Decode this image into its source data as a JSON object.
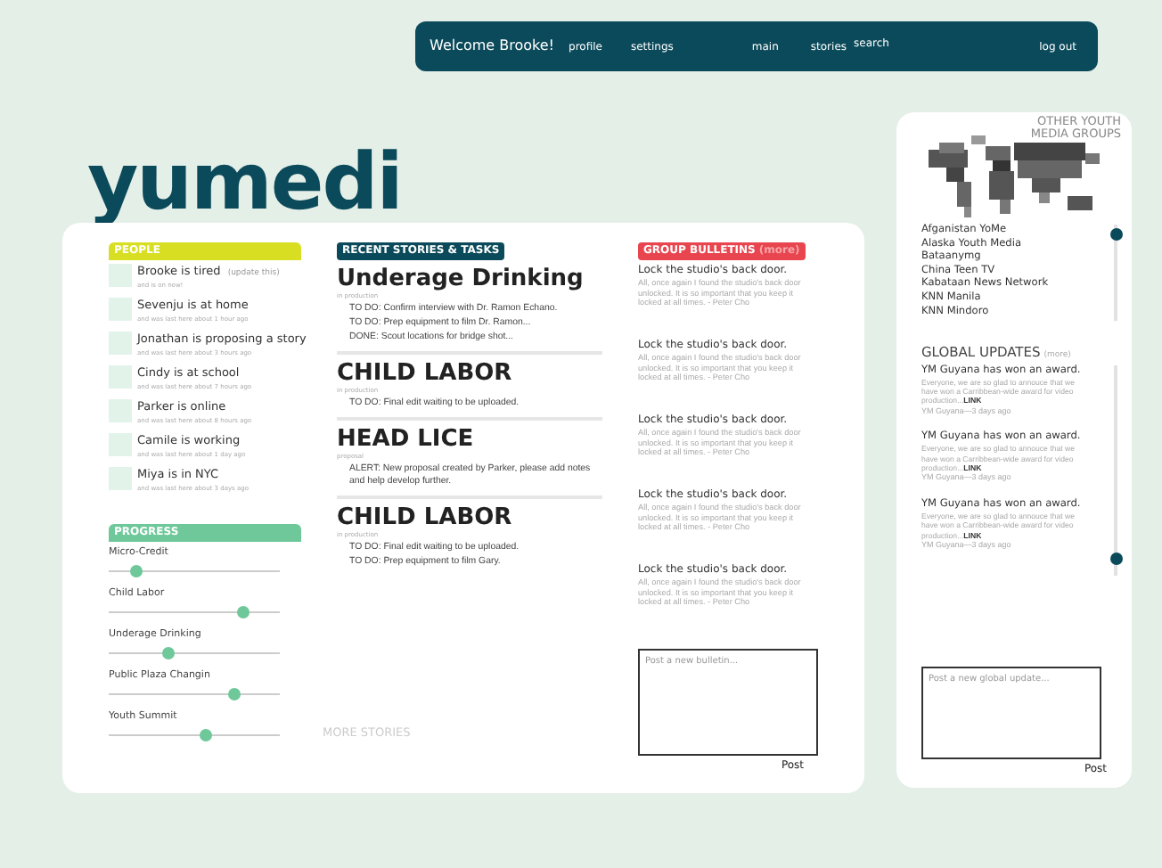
{
  "nav": {
    "welcome": "Welcome Brooke!",
    "links": [
      "profile",
      "settings",
      "main",
      "stories",
      "search",
      "log out"
    ]
  },
  "logo": "yumedi",
  "people": {
    "title": "PEOPLE",
    "items": [
      {
        "status": "Brooke is tired",
        "update_link": "(update this)",
        "note": "and is on now!"
      },
      {
        "status": "Sevenju is at home",
        "note": "and was last here about 1 hour ago"
      },
      {
        "status": "Jonathan is proposing a story",
        "note": "and was last here about 3 hours ago"
      },
      {
        "status": "Cindy is at school",
        "note": "and was last here about 7 hours ago"
      },
      {
        "status": "Parker is online",
        "note": "and was last here about 8 hours ago"
      },
      {
        "status": "Camile is working",
        "note": "and was last here about 1 day ago"
      },
      {
        "status": "Miya is in NYC",
        "note": "and was last here about 3 days ago"
      }
    ]
  },
  "progress": {
    "title": "PROGRESS",
    "items": [
      {
        "label": "Micro-Credit",
        "level": 0.16
      },
      {
        "label": "Child Labor",
        "level": 0.79
      },
      {
        "label": "Underage Drinking",
        "level": 0.35
      },
      {
        "label": "Public Plaza Changin",
        "level": 0.73
      },
      {
        "label": "Youth Summit",
        "level": 0.57
      }
    ]
  },
  "stories": {
    "title": "RECENT STORIES & TASKS",
    "more": "MORE STORIES",
    "items": [
      {
        "title": "Underage Drinking",
        "stage": "in production",
        "tasks": [
          "TO DO: Confirm interview with Dr. Ramon Echano.",
          "TO DO: Prep equipment to film Dr. Ramon...",
          "DONE: Scout locations for bridge shot..."
        ]
      },
      {
        "title": "CHILD LABOR",
        "stage": "in production",
        "tasks": [
          "TO DO: Final edit waiting to be uploaded."
        ]
      },
      {
        "title": "HEAD LICE",
        "stage": "proposal",
        "tasks": [
          "ALERT: New proposal created by Parker, please add notes and help develop further."
        ]
      },
      {
        "title": "CHILD LABOR",
        "stage": "in production",
        "tasks": [
          "TO DO: Final edit waiting to be uploaded.",
          "TO DO: Prep equipment to film Gary."
        ]
      }
    ]
  },
  "bulletins": {
    "title": "GROUP BULLETINS",
    "more": "(more)",
    "items": [
      {
        "title": "Lock the studio's back door.",
        "body": "All, once again I found the studio's back door unlocked. It is so important that you keep it locked at all times. - Peter Cho"
      },
      {
        "title": "Lock the studio's back door.",
        "body": "All, once again I found the studio's back door unlocked. It is so important that you keep it locked at all times. - Peter Cho"
      },
      {
        "title": "Lock the studio's back door.",
        "body": "All, once again I found the studio's back door unlocked. It is so important that you keep it locked at all times. - Peter Cho"
      },
      {
        "title": "Lock the studio's back door.",
        "body": "All, once again I found the studio's back door unlocked. It is so important that you keep it locked at all times. - Peter Cho"
      },
      {
        "title": "Lock the studio's back door.",
        "body": "All, once again I found the studio's back door unlocked. It is so important that you keep it locked at all times. - Peter Cho"
      }
    ],
    "placeholder": "Post a new bulletin...",
    "post": "Post"
  },
  "groups": {
    "title": "OTHER YOUTH MEDIA GROUPS",
    "items": [
      "Afganistan YoMe",
      "Alaska Youth Media",
      "Bataanymg",
      "China Teen TV",
      "Kabataan News Network",
      "KNN Manila",
      "KNN Mindoro"
    ]
  },
  "updates": {
    "title": "GLOBAL UPDATES",
    "more": "(more)",
    "items": [
      {
        "title": "YM Guyana has won an award.",
        "body": "Everyone, we are so glad to annouce that we have won a Carribbean-wide award for video production...",
        "link": "LINK",
        "meta": "YM Guyana—3 days ago"
      },
      {
        "title": "YM Guyana has won an award.",
        "body": "Everyone, we are so glad to annouce that we have won a Carribbean-wide award for video production...",
        "link": "LINK",
        "meta": "YM Guyana—3 days ago"
      },
      {
        "title": "YM Guyana has won an award.",
        "body": "Everyone, we are so glad to annouce that we have won a Carribbean-wide award for video production...",
        "link": "LINK",
        "meta": "YM Guyana—3 days ago"
      }
    ],
    "placeholder": "Post a new global update...",
    "post": "Post"
  }
}
